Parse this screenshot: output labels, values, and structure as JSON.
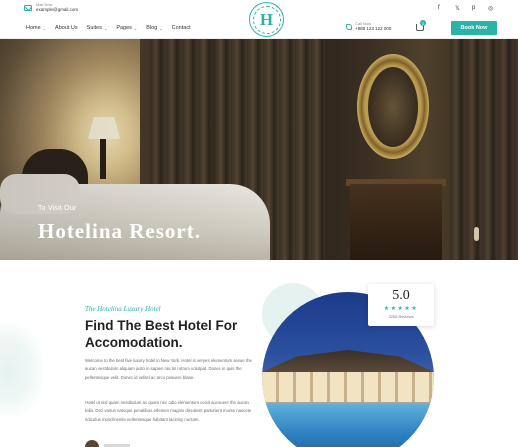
{
  "header": {
    "email_label": "Mail Now",
    "email_value": "example@gmail.com",
    "phone_label": "Call Now",
    "phone_value": "+888 123 122 000",
    "logo_letter": "H",
    "cart_count": "0",
    "book_label": "Book Now",
    "nav": [
      {
        "label": "Home",
        "has_dropdown": true
      },
      {
        "label": "About Us",
        "has_dropdown": false
      },
      {
        "label": "Suites",
        "has_dropdown": true
      },
      {
        "label": "Pages",
        "has_dropdown": true
      },
      {
        "label": "Blog",
        "has_dropdown": true
      },
      {
        "label": "Contact",
        "has_dropdown": false
      }
    ],
    "social_icons": [
      "facebook-icon",
      "twitter-icon",
      "pinterest-icon",
      "instagram-icon"
    ],
    "social_glyphs": [
      "f",
      "𝕏",
      "p",
      "◎"
    ]
  },
  "hero": {
    "subtitle": "To Visit Our",
    "title": "Hotelina Resort."
  },
  "about": {
    "script_subtitle": "The Hotelina Luxury Hotel",
    "title": "Find The Best Hotel For Accomodation.",
    "paragraph_1": "Welcome to the best five luxury hotel in New York. Hotel is veryes elementum sesue the aucan vestibulum aliquam justo in sapien ras tin rutrum volutpat. Donec in quis the pellentesque velit. Donec id velitel ac arcu posuere blane.",
    "paragraph_2": "Hotel ut nisl quam nestibulum ac quam nec odio elementum ceisit aucsuere the aucan tella. Orci varius natoque penatibus etfemen magnis discatent parturient monte nascete ridiculus musclinenite nellentesque habitant lacinisy nuctam.",
    "rating": {
      "value": "5.0",
      "stars": "★★★★★",
      "count": "3265 Reviews"
    }
  },
  "colors": {
    "accent": "#2bb3a7",
    "text_dark": "#222222",
    "text_muted": "#6b6b6b"
  }
}
